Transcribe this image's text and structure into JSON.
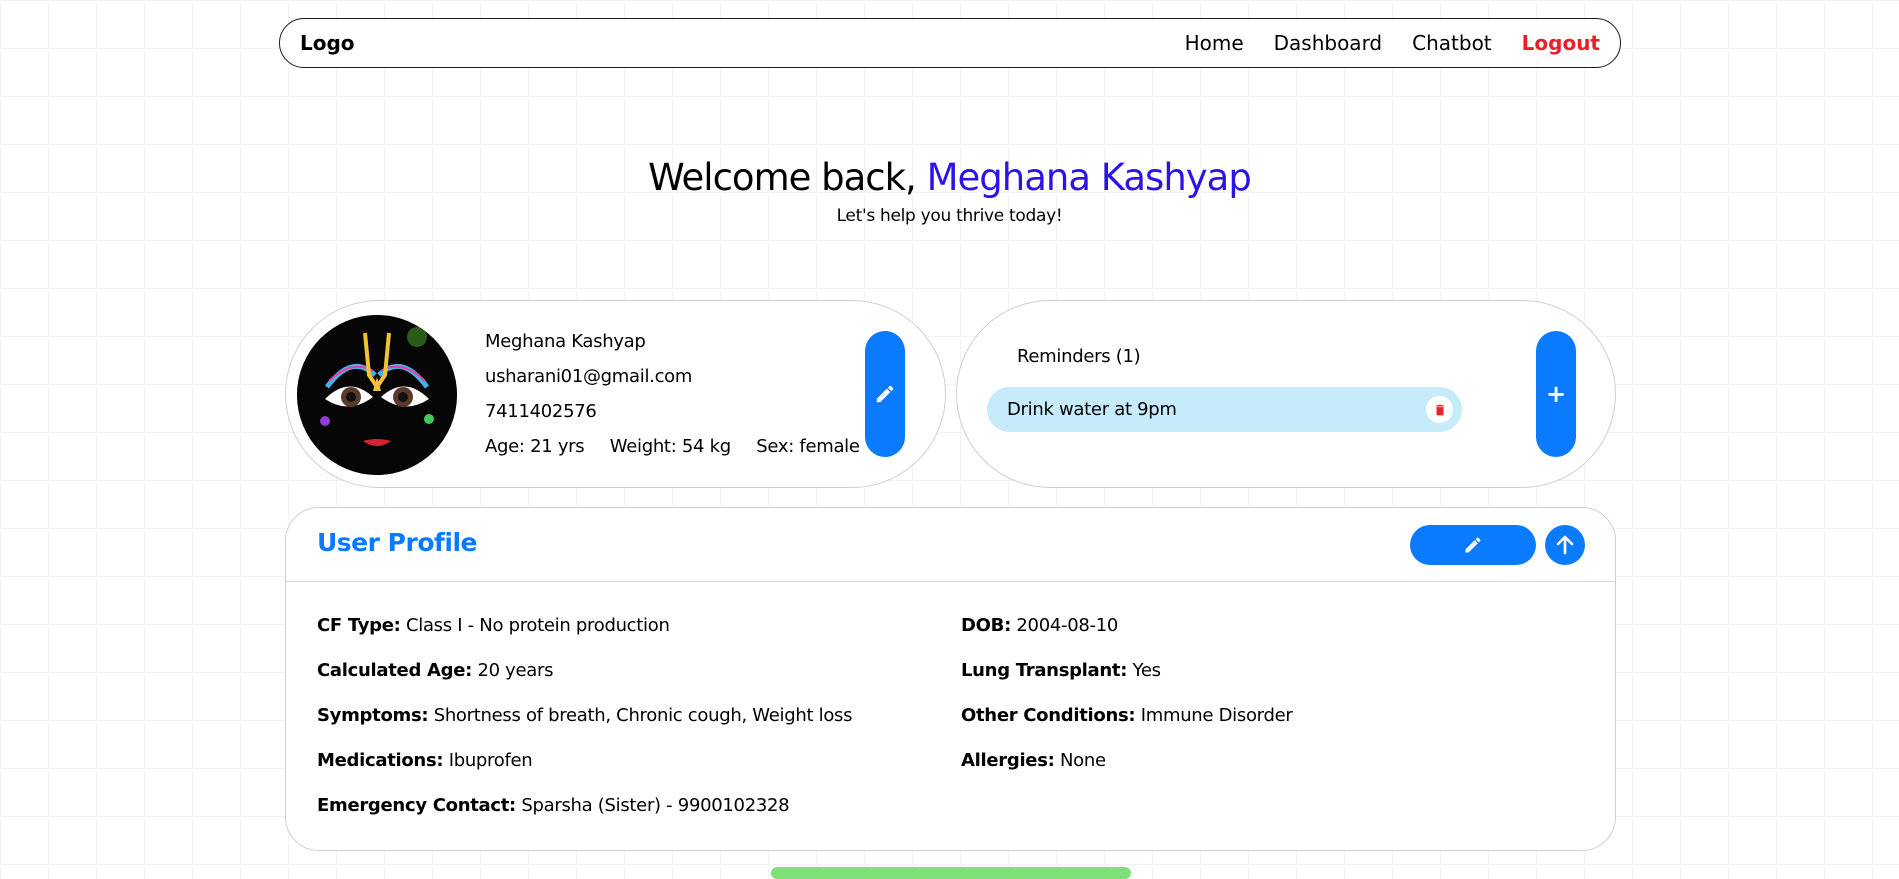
{
  "nav": {
    "logo": "Logo",
    "links": {
      "home": "Home",
      "dashboard": "Dashboard",
      "chatbot": "Chatbot",
      "logout": "Logout"
    }
  },
  "hero": {
    "greeting": "Welcome back,",
    "name": "Meghana Kashyap",
    "tagline": "Let's help you thrive today!"
  },
  "profile_card": {
    "name": "Meghana Kashyap",
    "email": "usharani01@gmail.com",
    "phone": "7411402576",
    "age": "Age: 21 yrs",
    "weight": "Weight: 54 kg",
    "sex": "Sex: female"
  },
  "reminders": {
    "title": "Reminders (1)",
    "items": [
      {
        "text": "Drink water at 9pm"
      }
    ]
  },
  "user_profile": {
    "title": "User Profile",
    "left": [
      {
        "label": "CF Type:",
        "value": "Class I - No protein production"
      },
      {
        "label": "Calculated Age:",
        "value": "20 years"
      },
      {
        "label": "Symptoms:",
        "value": "Shortness of breath, Chronic cough, Weight loss"
      },
      {
        "label": "Medications:",
        "value": "Ibuprofen"
      },
      {
        "label": "Emergency Contact:",
        "value": "Sparsha (Sister) - 9900102328"
      }
    ],
    "right": [
      {
        "label": "DOB:",
        "value": "2004-08-10"
      },
      {
        "label": "Lung Transplant:",
        "value": "Yes"
      },
      {
        "label": "Other Conditions:",
        "value": "Immune Disorder"
      },
      {
        "label": "Allergies:",
        "value": "None"
      }
    ]
  },
  "colors": {
    "accent": "#0a7bff",
    "name_highlight": "#2d14e6",
    "logout": "#ee1d2c",
    "reminder_bg": "#c6ebfb",
    "delete": "#ee1d2c"
  },
  "icons": {
    "edit": "pencil-icon",
    "add": "plus-icon",
    "delete": "trash-icon",
    "collapse": "arrow-up-icon"
  }
}
